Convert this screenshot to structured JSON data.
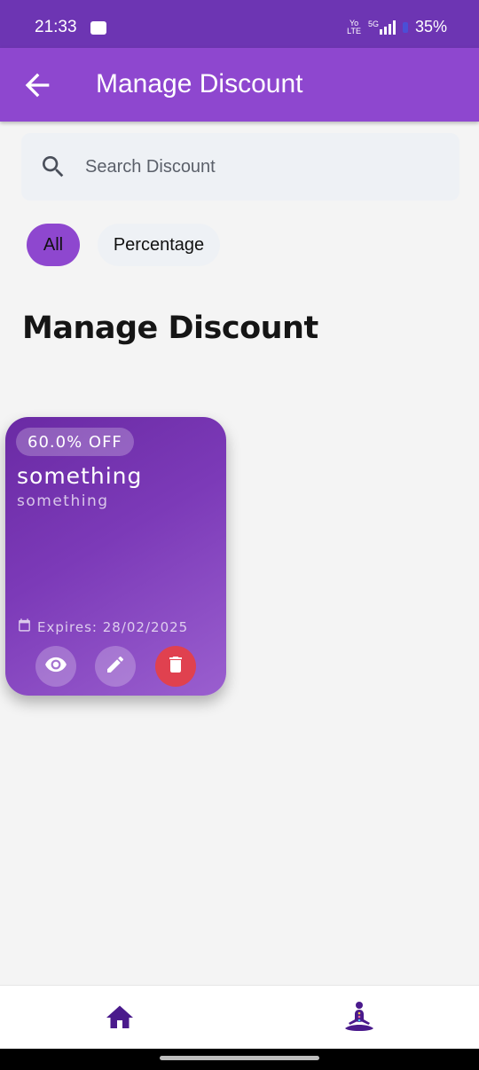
{
  "status_bar": {
    "time": "21:33",
    "network_top": "Yo",
    "network_bottom": "LTE",
    "network_type": "5G",
    "battery": "35%"
  },
  "app_bar": {
    "title": "Manage Discount",
    "back_icon": "arrow-left-icon"
  },
  "search": {
    "placeholder": "Search Discount",
    "value": "",
    "icon": "search-icon"
  },
  "filters": {
    "chips": [
      {
        "label": "All",
        "selected": true
      },
      {
        "label": "Percentage",
        "selected": false
      }
    ]
  },
  "section": {
    "title": "Manage Discount"
  },
  "discounts": [
    {
      "badge": "60.0% OFF",
      "title": "something",
      "description": "something",
      "expiry": "Expires: 28/02/2025",
      "actions": [
        "eye-icon",
        "pencil-icon",
        "trash-icon"
      ]
    }
  ],
  "bottom_nav": {
    "items": [
      "home-icon",
      "meditation-icon"
    ]
  },
  "colors": {
    "primary": "#8e47cf",
    "status_bar": "#6d35b3",
    "delete": "#e0414f",
    "nav_icon": "#4a1a8c"
  }
}
